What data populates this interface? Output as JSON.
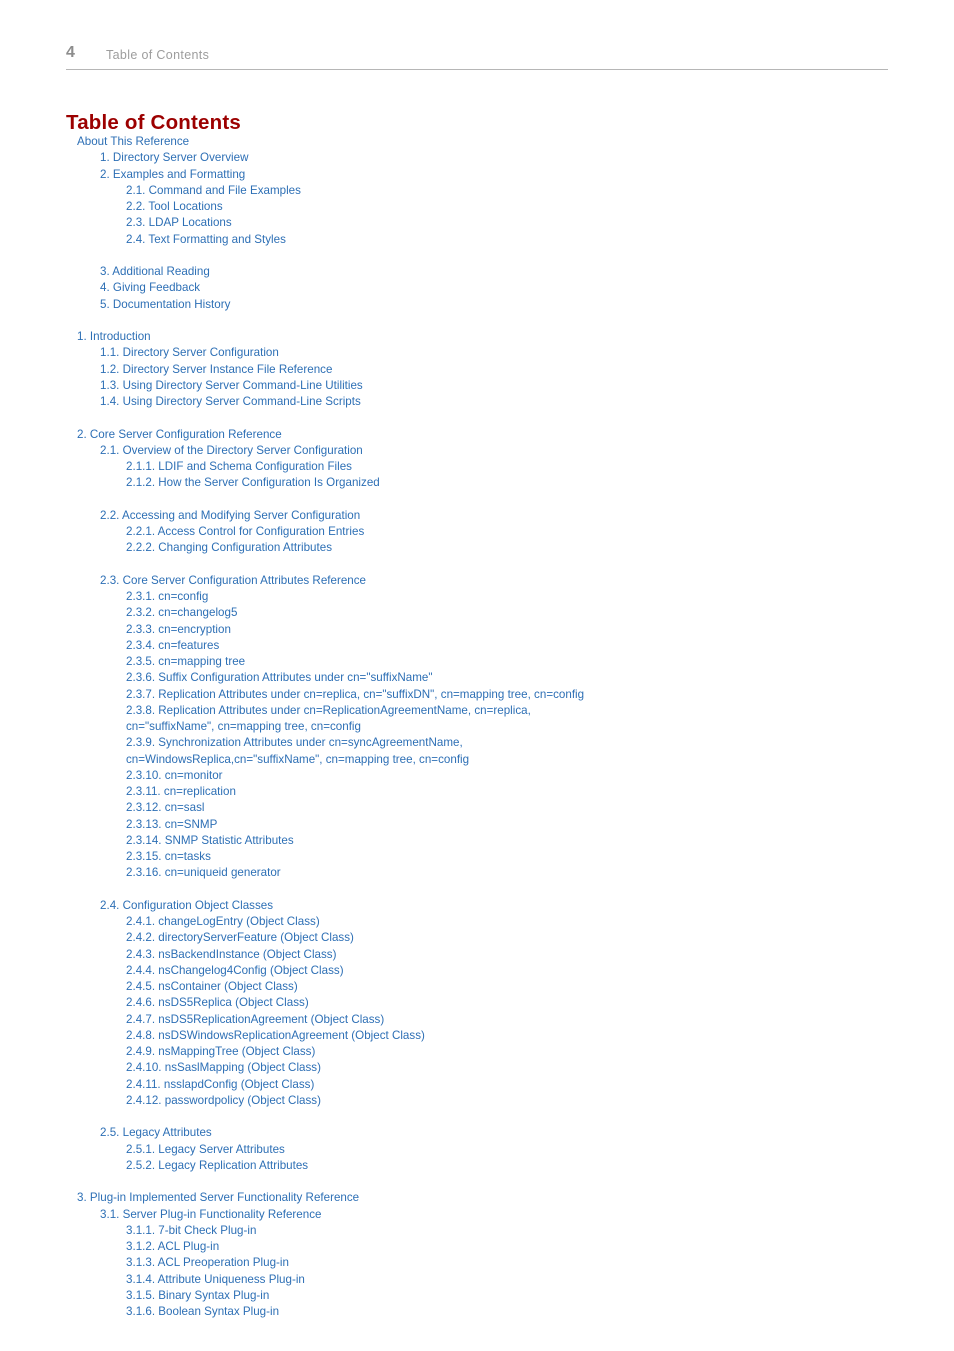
{
  "header": {
    "page_number": "4",
    "running_title": "Table of Contents"
  },
  "heading": "Table of Contents",
  "colors": {
    "link": "#2d6fb5",
    "heading": "#9c0000",
    "header_text": "#9d9d9d",
    "folio": "#8d8d8d",
    "rule": "#b6b6b6",
    "background": "#ffffff"
  },
  "toc": {
    "entries": [
      {
        "text": "About This Reference",
        "level": 1,
        "gap_before": false,
        "wrap": false
      },
      {
        "text": "1. Directory Server Overview",
        "level": 2,
        "gap_before": false,
        "wrap": false
      },
      {
        "text": "2. Examples and Formatting",
        "level": 2,
        "gap_before": false,
        "wrap": false
      },
      {
        "text": "2.1. Command and File Examples",
        "level": 3,
        "gap_before": false,
        "wrap": false
      },
      {
        "text": "2.2. Tool Locations",
        "level": 3,
        "gap_before": false,
        "wrap": false
      },
      {
        "text": "2.3. LDAP Locations",
        "level": 3,
        "gap_before": false,
        "wrap": false
      },
      {
        "text": "2.4. Text Formatting and Styles",
        "level": 3,
        "gap_before": false,
        "wrap": false
      },
      {
        "text": "3. Additional Reading",
        "level": 2,
        "gap_before": true,
        "wrap": false
      },
      {
        "text": "4. Giving Feedback",
        "level": 2,
        "gap_before": false,
        "wrap": false
      },
      {
        "text": "5. Documentation History",
        "level": 2,
        "gap_before": false,
        "wrap": false
      },
      {
        "text": "1. Introduction",
        "level": 1,
        "gap_before": true,
        "wrap": false
      },
      {
        "text": "1.1. Directory Server Configuration",
        "level": 2,
        "gap_before": false,
        "wrap": false
      },
      {
        "text": "1.2. Directory Server Instance File Reference",
        "level": 2,
        "gap_before": false,
        "wrap": false
      },
      {
        "text": "1.3. Using Directory Server Command-Line Utilities",
        "level": 2,
        "gap_before": false,
        "wrap": false
      },
      {
        "text": "1.4. Using Directory Server Command-Line Scripts",
        "level": 2,
        "gap_before": false,
        "wrap": false
      },
      {
        "text": "2. Core Server Configuration Reference",
        "level": 1,
        "gap_before": true,
        "wrap": false
      },
      {
        "text": "2.1. Overview of the Directory Server Configuration",
        "level": 2,
        "gap_before": false,
        "wrap": false
      },
      {
        "text": "2.1.1. LDIF and Schema Configuration Files",
        "level": 3,
        "gap_before": false,
        "wrap": false
      },
      {
        "text": "2.1.2. How the Server Configuration Is Organized",
        "level": 3,
        "gap_before": false,
        "wrap": false
      },
      {
        "text": "2.2. Accessing and Modifying Server Configuration",
        "level": 2,
        "gap_before": true,
        "wrap": false
      },
      {
        "text": "2.2.1. Access Control for Configuration Entries",
        "level": 3,
        "gap_before": false,
        "wrap": false
      },
      {
        "text": "2.2.2. Changing Configuration Attributes",
        "level": 3,
        "gap_before": false,
        "wrap": false
      },
      {
        "text": "2.3. Core Server Configuration Attributes Reference",
        "level": 2,
        "gap_before": true,
        "wrap": false
      },
      {
        "text": "2.3.1. cn=config",
        "level": 3,
        "gap_before": false,
        "wrap": false
      },
      {
        "text": "2.3.2. cn=changelog5",
        "level": 3,
        "gap_before": false,
        "wrap": false
      },
      {
        "text": "2.3.3. cn=encryption",
        "level": 3,
        "gap_before": false,
        "wrap": false
      },
      {
        "text": "2.3.4. cn=features",
        "level": 3,
        "gap_before": false,
        "wrap": false
      },
      {
        "text": "2.3.5. cn=mapping tree",
        "level": 3,
        "gap_before": false,
        "wrap": false
      },
      {
        "text": "2.3.6. Suffix Configuration Attributes under cn=\"suffixName\"",
        "level": 3,
        "gap_before": false,
        "wrap": false
      },
      {
        "text": "2.3.7. Replication Attributes under cn=replica, cn=\"suffixDN\", cn=mapping tree, cn=config",
        "level": 3,
        "gap_before": false,
        "wrap": false
      },
      {
        "text": "2.3.8. Replication Attributes under cn=ReplicationAgreementName, cn=replica,",
        "level": 3,
        "gap_before": false,
        "wrap": false
      },
      {
        "text": "cn=\"suffixName\", cn=mapping tree, cn=config",
        "level": 3,
        "gap_before": false,
        "wrap": true
      },
      {
        "text": "2.3.9. Synchronization Attributes under cn=syncAgreementName,",
        "level": 3,
        "gap_before": false,
        "wrap": false
      },
      {
        "text": "cn=WindowsReplica,cn=\"suffixName\", cn=mapping tree, cn=config",
        "level": 3,
        "gap_before": false,
        "wrap": true
      },
      {
        "text": "2.3.10. cn=monitor",
        "level": 3,
        "gap_before": false,
        "wrap": false
      },
      {
        "text": "2.3.11. cn=replication",
        "level": 3,
        "gap_before": false,
        "wrap": false
      },
      {
        "text": "2.3.12. cn=sasl",
        "level": 3,
        "gap_before": false,
        "wrap": false
      },
      {
        "text": "2.3.13. cn=SNMP",
        "level": 3,
        "gap_before": false,
        "wrap": false
      },
      {
        "text": "2.3.14. SNMP Statistic Attributes",
        "level": 3,
        "gap_before": false,
        "wrap": false
      },
      {
        "text": "2.3.15. cn=tasks",
        "level": 3,
        "gap_before": false,
        "wrap": false
      },
      {
        "text": "2.3.16. cn=uniqueid generator",
        "level": 3,
        "gap_before": false,
        "wrap": false
      },
      {
        "text": "2.4. Configuration Object Classes",
        "level": 2,
        "gap_before": true,
        "wrap": false
      },
      {
        "text": "2.4.1. changeLogEntry (Object Class)",
        "level": 3,
        "gap_before": false,
        "wrap": false
      },
      {
        "text": "2.4.2. directoryServerFeature (Object Class)",
        "level": 3,
        "gap_before": false,
        "wrap": false
      },
      {
        "text": "2.4.3. nsBackendInstance (Object Class)",
        "level": 3,
        "gap_before": false,
        "wrap": false
      },
      {
        "text": "2.4.4. nsChangelog4Config (Object Class)",
        "level": 3,
        "gap_before": false,
        "wrap": false
      },
      {
        "text": "2.4.5. nsContainer (Object Class)",
        "level": 3,
        "gap_before": false,
        "wrap": false
      },
      {
        "text": "2.4.6. nsDS5Replica (Object Class)",
        "level": 3,
        "gap_before": false,
        "wrap": false
      },
      {
        "text": "2.4.7. nsDS5ReplicationAgreement (Object Class)",
        "level": 3,
        "gap_before": false,
        "wrap": false
      },
      {
        "text": "2.4.8. nsDSWindowsReplicationAgreement (Object Class)",
        "level": 3,
        "gap_before": false,
        "wrap": false
      },
      {
        "text": "2.4.9. nsMappingTree (Object Class)",
        "level": 3,
        "gap_before": false,
        "wrap": false
      },
      {
        "text": "2.4.10. nsSaslMapping (Object Class)",
        "level": 3,
        "gap_before": false,
        "wrap": false
      },
      {
        "text": "2.4.11. nsslapdConfig (Object Class)",
        "level": 3,
        "gap_before": false,
        "wrap": false
      },
      {
        "text": "2.4.12. passwordpolicy (Object Class)",
        "level": 3,
        "gap_before": false,
        "wrap": false
      },
      {
        "text": "2.5. Legacy Attributes",
        "level": 2,
        "gap_before": true,
        "wrap": false
      },
      {
        "text": "2.5.1. Legacy Server Attributes",
        "level": 3,
        "gap_before": false,
        "wrap": false
      },
      {
        "text": "2.5.2. Legacy Replication Attributes",
        "level": 3,
        "gap_before": false,
        "wrap": false
      },
      {
        "text": "3. Plug-in Implemented Server Functionality Reference",
        "level": 1,
        "gap_before": true,
        "wrap": false
      },
      {
        "text": "3.1. Server Plug-in Functionality Reference",
        "level": 2,
        "gap_before": false,
        "wrap": false
      },
      {
        "text": "3.1.1. 7-bit Check Plug-in",
        "level": 3,
        "gap_before": false,
        "wrap": false
      },
      {
        "text": "3.1.2. ACL Plug-in",
        "level": 3,
        "gap_before": false,
        "wrap": false
      },
      {
        "text": "3.1.3. ACL Preoperation Plug-in",
        "level": 3,
        "gap_before": false,
        "wrap": false
      },
      {
        "text": "3.1.4. Attribute Uniqueness Plug-in",
        "level": 3,
        "gap_before": false,
        "wrap": false
      },
      {
        "text": "3.1.5. Binary Syntax Plug-in",
        "level": 3,
        "gap_before": false,
        "wrap": false
      },
      {
        "text": "3.1.6. Boolean Syntax Plug-in",
        "level": 3,
        "gap_before": false,
        "wrap": false
      }
    ]
  }
}
